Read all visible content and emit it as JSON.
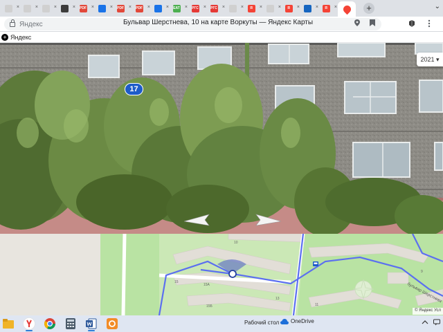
{
  "browser": {
    "tabs": [
      {
        "icon": "doc-icon",
        "color": "#d0d0d0",
        "text": ""
      },
      {
        "icon": "doc-icon",
        "color": "#d0d0d0",
        "text": ""
      },
      {
        "icon": "doc-icon",
        "color": "#d0d0d0",
        "text": ""
      },
      {
        "icon": "file-icon",
        "color": "#3c3c3c",
        "text": ""
      },
      {
        "icon": "pdf-icon",
        "color": "#e2483a",
        "text": "PDF"
      },
      {
        "icon": "mail-icon",
        "color": "#1a73e8",
        "text": ""
      },
      {
        "icon": "pdf-icon",
        "color": "#e2483a",
        "text": "PDF"
      },
      {
        "icon": "pdf-icon",
        "color": "#e2483a",
        "text": "PDF"
      },
      {
        "icon": "mail-icon",
        "color": "#1a73e8",
        "text": ""
      },
      {
        "icon": "eat-icon",
        "color": "#4caf50",
        "text": "EAT"
      },
      {
        "icon": "pgs-icon",
        "color": "#e53935",
        "text": "PГС"
      },
      {
        "icon": "pgs-icon",
        "color": "#e53935",
        "text": "PГС"
      },
      {
        "icon": "doc-icon",
        "color": "#d0d0d0",
        "text": ""
      },
      {
        "icon": "yandex-icon",
        "color": "#f44336",
        "text": "Я"
      },
      {
        "icon": "doc-icon",
        "color": "#d0d0d0",
        "text": ""
      },
      {
        "icon": "yandex-icon",
        "color": "#f44336",
        "text": "Я"
      },
      {
        "icon": "globe-icon",
        "color": "#1565c0",
        "text": ""
      },
      {
        "icon": "yandex-icon",
        "color": "#f44336",
        "text": "Я"
      },
      {
        "icon": "maps-pin-icon",
        "color": "#f44336",
        "text": "",
        "active": true
      }
    ],
    "new_tab": "+",
    "window_control": "⌄"
  },
  "address": {
    "site": "Яндекс",
    "title": "Бульвар Шерстнева, 10 на карте Воркуты — Яндекс Карты"
  },
  "bookmarks": {
    "label": "Яндекс"
  },
  "panorama": {
    "year": "2021 ▾",
    "house_number": "17"
  },
  "map": {
    "labels": {
      "b10": "10",
      "b15": "15",
      "b15a": "15А",
      "b15b": "15Б",
      "b13": "13",
      "b11": "11",
      "b9": "9"
    },
    "street": "бульвар Шерстнева",
    "copyright": "© Яндекс  Усл"
  },
  "taskbar": {
    "desktop_label": "Рабочий стол",
    "onedrive_label": "OneDrive"
  },
  "colors": {
    "accent": "#1e5cc8",
    "route": "#5b6ff0"
  }
}
